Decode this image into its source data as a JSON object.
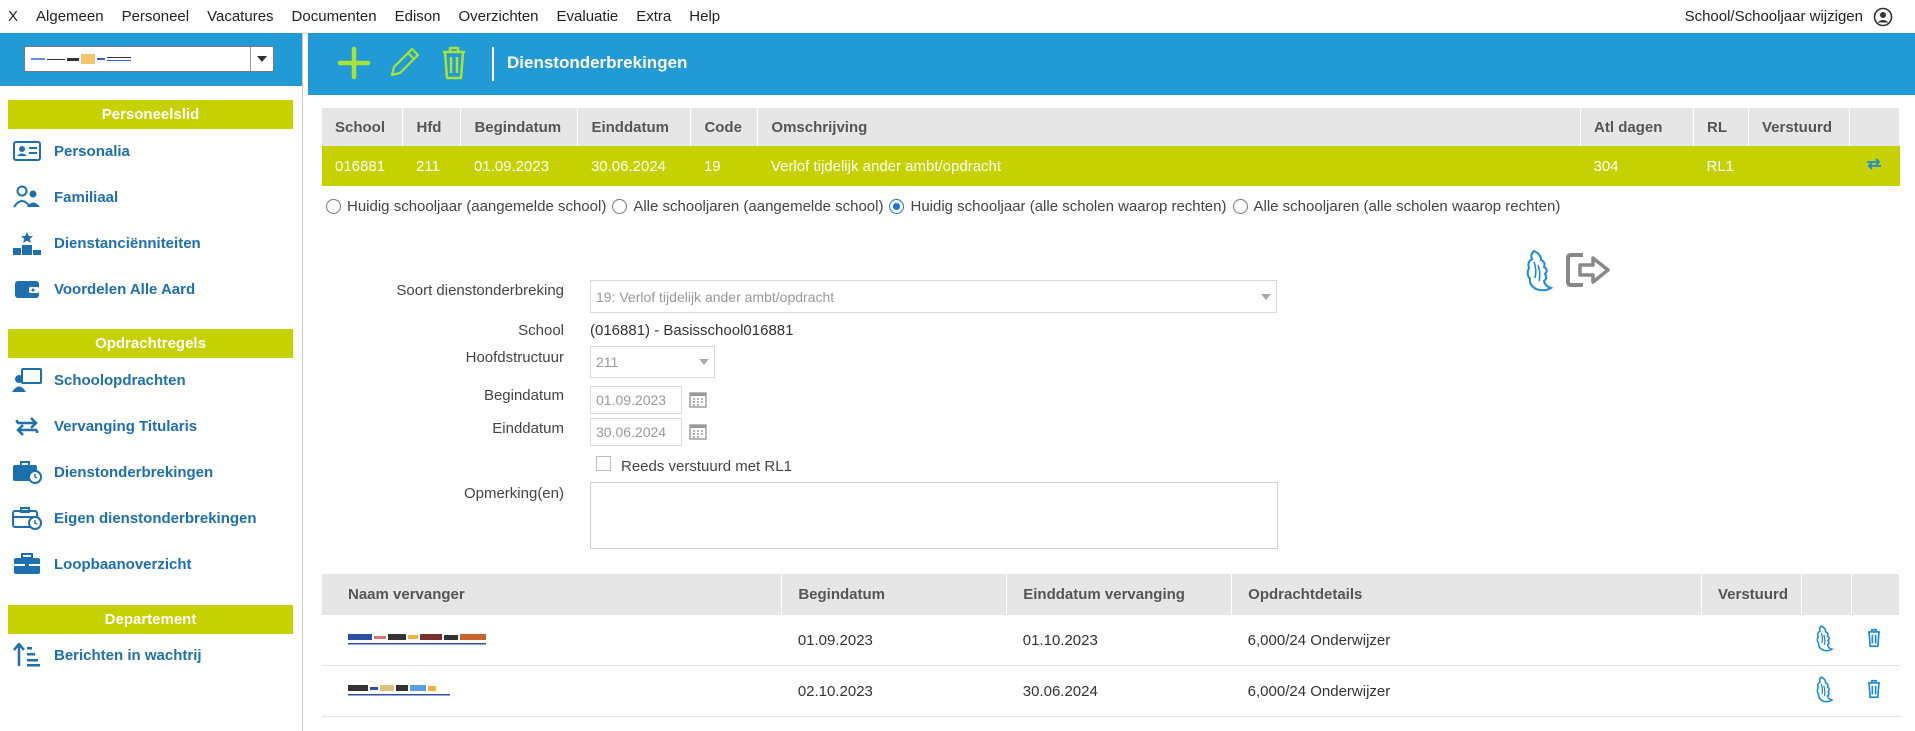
{
  "menubar": {
    "items": [
      "X",
      "Algemeen",
      "Personeel",
      "Vacatures",
      "Documenten",
      "Edison",
      "Overzichten",
      "Evaluatie",
      "Extra",
      "Help"
    ],
    "school_switch": "School/Schooljaar wijzigen",
    "user_icon": "user-circle-icon"
  },
  "sidebar": {
    "section1": {
      "title": "Personeelslid",
      "items": [
        {
          "label": "Personalia",
          "icon": "id-card-icon"
        },
        {
          "label": "Familiaal",
          "icon": "family-icon"
        },
        {
          "label": "Dienstanciënniteiten",
          "icon": "podium-icon"
        },
        {
          "label": "Voordelen Alle Aard",
          "icon": "wallet-icon"
        }
      ]
    },
    "section2": {
      "title": "Opdrachtregels",
      "items": [
        {
          "label": "Schoolopdrachten",
          "icon": "teacher-icon"
        },
        {
          "label": "Vervanging Titularis",
          "icon": "swap-icon"
        },
        {
          "label": "Dienstonderbrekingen",
          "icon": "briefcase-clock-icon"
        },
        {
          "label": "Eigen dienstonderbrekingen",
          "icon": "briefcase-clock-outline-icon"
        },
        {
          "label": "Loopbaanoverzicht",
          "icon": "briefcase-icon"
        }
      ]
    },
    "section3": {
      "title": "Departement",
      "items": [
        {
          "label": "Berichten in wachtrij",
          "icon": "sort-queue-icon"
        }
      ]
    }
  },
  "header": {
    "title": "Dienstonderbrekingen",
    "tools": [
      "add-icon",
      "edit-pencil-icon",
      "delete-trash-icon"
    ],
    "color": "#229ad6"
  },
  "grid1": {
    "columns": [
      "School",
      "Hfd",
      "Begindatum",
      "Einddatum",
      "Code",
      "Omschrijving",
      "Atl dagen",
      "RL",
      "Verstuurd"
    ],
    "rows": [
      {
        "school": "016881",
        "hfd": "211",
        "begin": "01.09.2023",
        "eind": "30.06.2024",
        "code": "19",
        "omschrijving": "Verlof tijdelijk ander ambt/opdracht",
        "atl": "304",
        "rl": "RL1"
      }
    ],
    "selected_color": "#c5d200"
  },
  "radios": {
    "options": [
      "Huidig schooljaar (aangemelde school)",
      "Alle schooljaren (aangemelde school)",
      "Huidig schooljaar (alle scholen waarop rechten)",
      "Alle schooljaren (alle scholen waarop rechten)"
    ],
    "selected_index": 2
  },
  "form": {
    "soort_label": "Soort dienstonderbreking",
    "soort_value": "19: Verlof tijdelijk ander ambt/opdracht",
    "school_label": "School",
    "school_value": "(016881) - Basisschool016881",
    "hoofd_label": "Hoofdstructuur",
    "hoofd_value": "211",
    "begin_label": "Begindatum",
    "begin_value": "01.09.2023",
    "eind_label": "Einddatum",
    "eind_value": "30.06.2024",
    "reeds_label": "Reeds verstuurd met RL1",
    "reeds_checked": false,
    "opm_label": "Opmerking(en)",
    "opm_value": ""
  },
  "grid2": {
    "columns": [
      "Naam vervanger",
      "Begindatum",
      "Einddatum vervanging",
      "Opdrachtdetails",
      "Verstuurd"
    ],
    "rows": [
      {
        "begin": "01.09.2023",
        "eind": "01.10.2023",
        "details": "6,000/24 Onderwijzer"
      },
      {
        "begin": "02.10.2023",
        "eind": "30.06.2024",
        "details": "6,000/24 Onderwijzer"
      }
    ]
  }
}
